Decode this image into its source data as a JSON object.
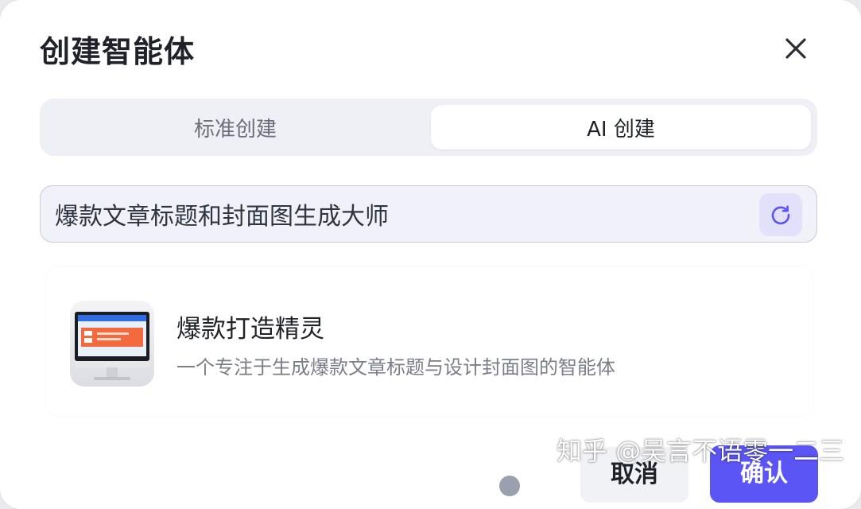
{
  "dialog": {
    "title": "创建智能体",
    "close_icon": "close-icon"
  },
  "tabs": [
    {
      "label": "标准创建",
      "active": false
    },
    {
      "label": "AI 创建",
      "active": true
    }
  ],
  "prompt": {
    "value": "爆款文章标题和封面图生成大师",
    "refresh_icon": "refresh-icon"
  },
  "agent": {
    "name": "爆款打造精灵",
    "description": "一个专注于生成爆款文章标题与设计封面图的智能体",
    "avatar_icon": "monitor-icon"
  },
  "footer": {
    "cancel_label": "取消",
    "confirm_label": "确认"
  },
  "watermark": "知乎 @吴言不语零一二三",
  "colors": {
    "accent": "#5b55f5",
    "refresh_bg": "#e3e0fb",
    "segment_bg": "#eef0f6"
  }
}
